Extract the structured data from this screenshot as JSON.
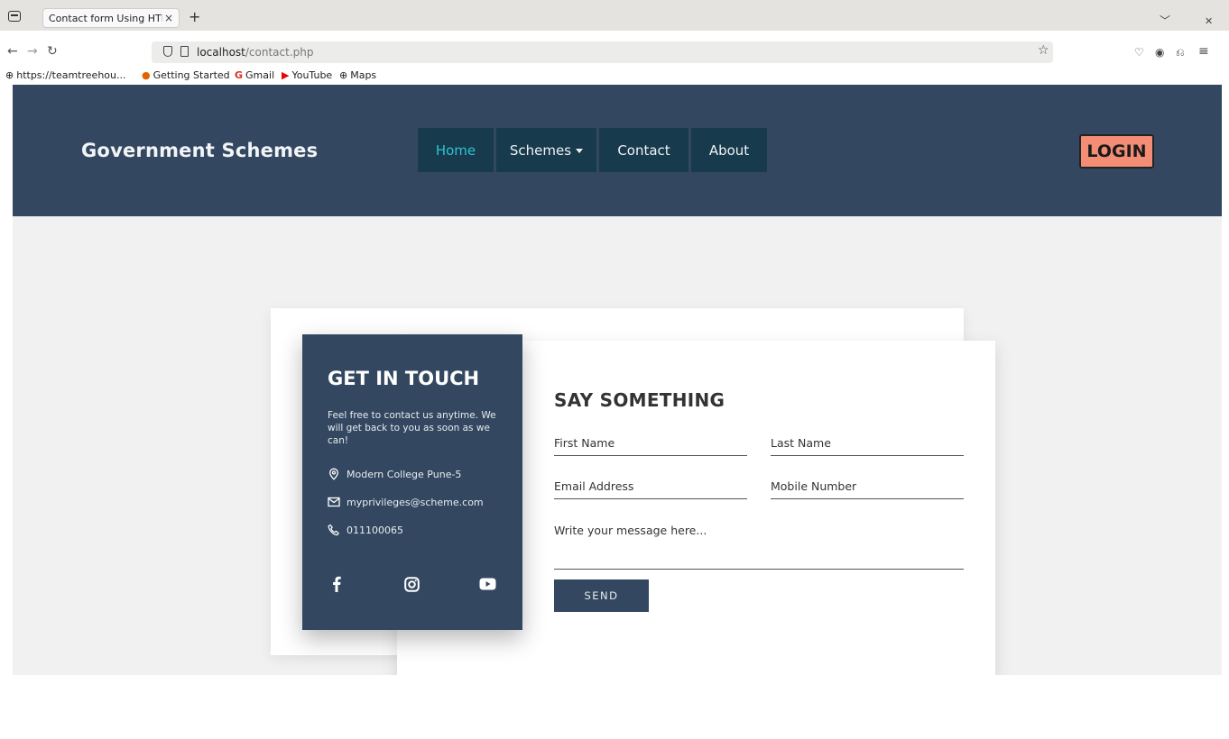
{
  "browser": {
    "tab_title": "Contact form Using HTML",
    "tab_close": "×",
    "new_tab": "+",
    "url_host": "localhost",
    "url_path": "/contact.php",
    "bookmarks": [
      {
        "label": "https://teamtreehou...",
        "icon": "globe-icon"
      },
      {
        "label": "Getting Started",
        "icon": "firefox-icon"
      },
      {
        "label": "Gmail",
        "icon": "google-icon"
      },
      {
        "label": "YouTube",
        "icon": "youtube-icon"
      },
      {
        "label": "Maps",
        "icon": "globe-icon"
      }
    ]
  },
  "site": {
    "brand": "Government Schemes",
    "nav": [
      {
        "label": "Home",
        "active": true
      },
      {
        "label": "Schemes",
        "active": false,
        "dropdown": true
      },
      {
        "label": "Contact",
        "active": false
      },
      {
        "label": "About",
        "active": false
      }
    ],
    "login_label": "LOGIN",
    "colors": {
      "header": "#334860",
      "nav_item": "#173a4d",
      "active_link": "#2ec3d1",
      "login": "#f48d75"
    }
  },
  "contact_info": {
    "title": "GET IN TOUCH",
    "description": "Feel free to contact us anytime. We will get back to you as soon as we can!",
    "address": "Modern College Pune-5",
    "email": "myprivileges@scheme.com",
    "phone": "011100065",
    "social": [
      "facebook-icon",
      "instagram-icon",
      "youtube-icon"
    ]
  },
  "form": {
    "title": "SAY SOMETHING",
    "first_name_placeholder": "First Name",
    "last_name_placeholder": "Last Name",
    "email_placeholder": "Email Address",
    "mobile_placeholder": "Mobile Number",
    "message_placeholder": "Write your message here...",
    "send_label": "SEND"
  }
}
